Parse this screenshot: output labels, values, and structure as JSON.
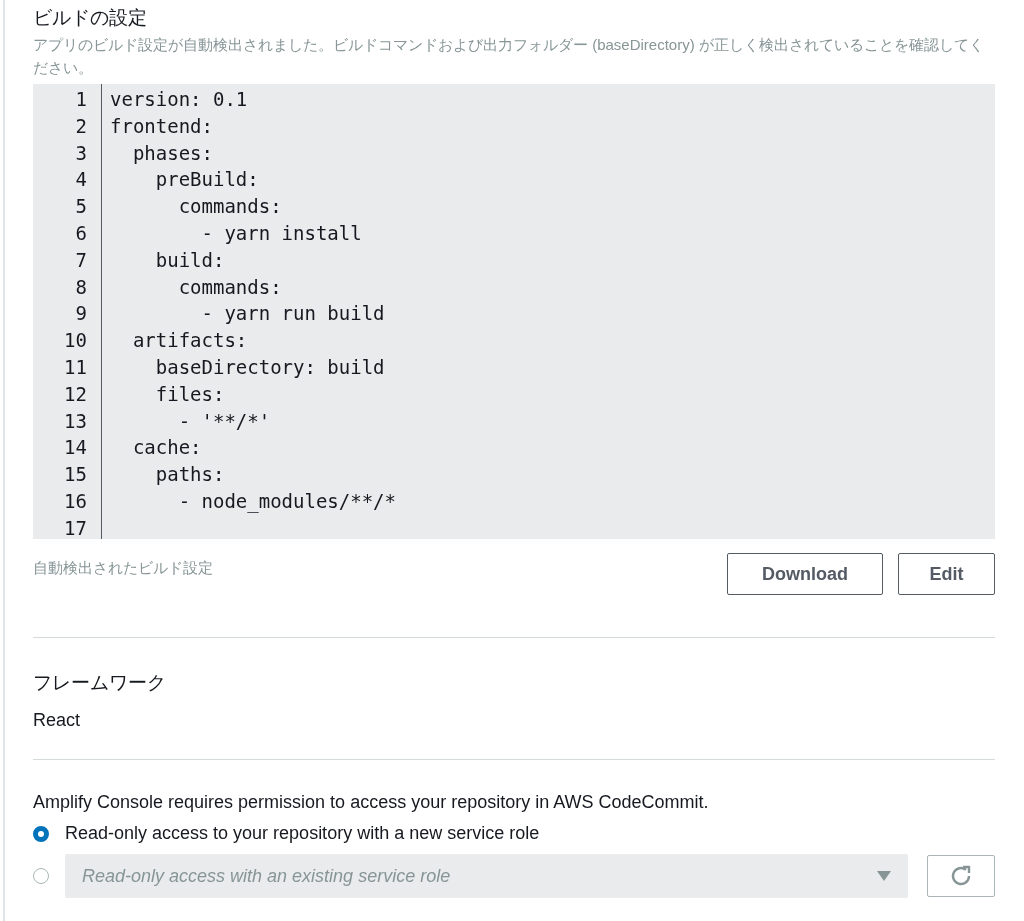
{
  "build_settings": {
    "title": "ビルドの設定",
    "description": "アプリのビルド設定が自動検出されました。ビルドコマンドおよび出力フォルダー (baseDirectory) が正しく検出されていることを確認してください。",
    "code_lines": [
      {
        "number": "1",
        "text": "version: 0.1"
      },
      {
        "number": "2",
        "text": "frontend:"
      },
      {
        "number": "3",
        "text": "  phases:"
      },
      {
        "number": "4",
        "text": "    preBuild:"
      },
      {
        "number": "5",
        "text": "      commands:"
      },
      {
        "number": "6",
        "text": "        - yarn install"
      },
      {
        "number": "7",
        "text": "    build:"
      },
      {
        "number": "8",
        "text": "      commands:"
      },
      {
        "number": "9",
        "text": "        - yarn run build"
      },
      {
        "number": "10",
        "text": "  artifacts:"
      },
      {
        "number": "11",
        "text": "    baseDirectory: build"
      },
      {
        "number": "12",
        "text": "    files:"
      },
      {
        "number": "13",
        "text": "      - '**/*'"
      },
      {
        "number": "14",
        "text": "  cache:"
      },
      {
        "number": "15",
        "text": "    paths:"
      },
      {
        "number": "16",
        "text": "      - node_modules/**/*"
      },
      {
        "number": "17"
      }
    ],
    "caption": "自動検出されたビルド設定",
    "buttons": [
      "Download",
      "Edit"
    ]
  },
  "framework": {
    "label": "フレームワーク",
    "value": "React"
  },
  "permissions": {
    "intro": "Amplify Console requires permission to access your repository in AWS CodeCommit.",
    "options": [
      {
        "kind": "plain",
        "label": "Read-only access to your repository with a new service role",
        "selected": true
      },
      {
        "kind": "select",
        "placeholder": "Read-only access with an existing service role",
        "selected": false,
        "disabled": true
      }
    ]
  }
}
